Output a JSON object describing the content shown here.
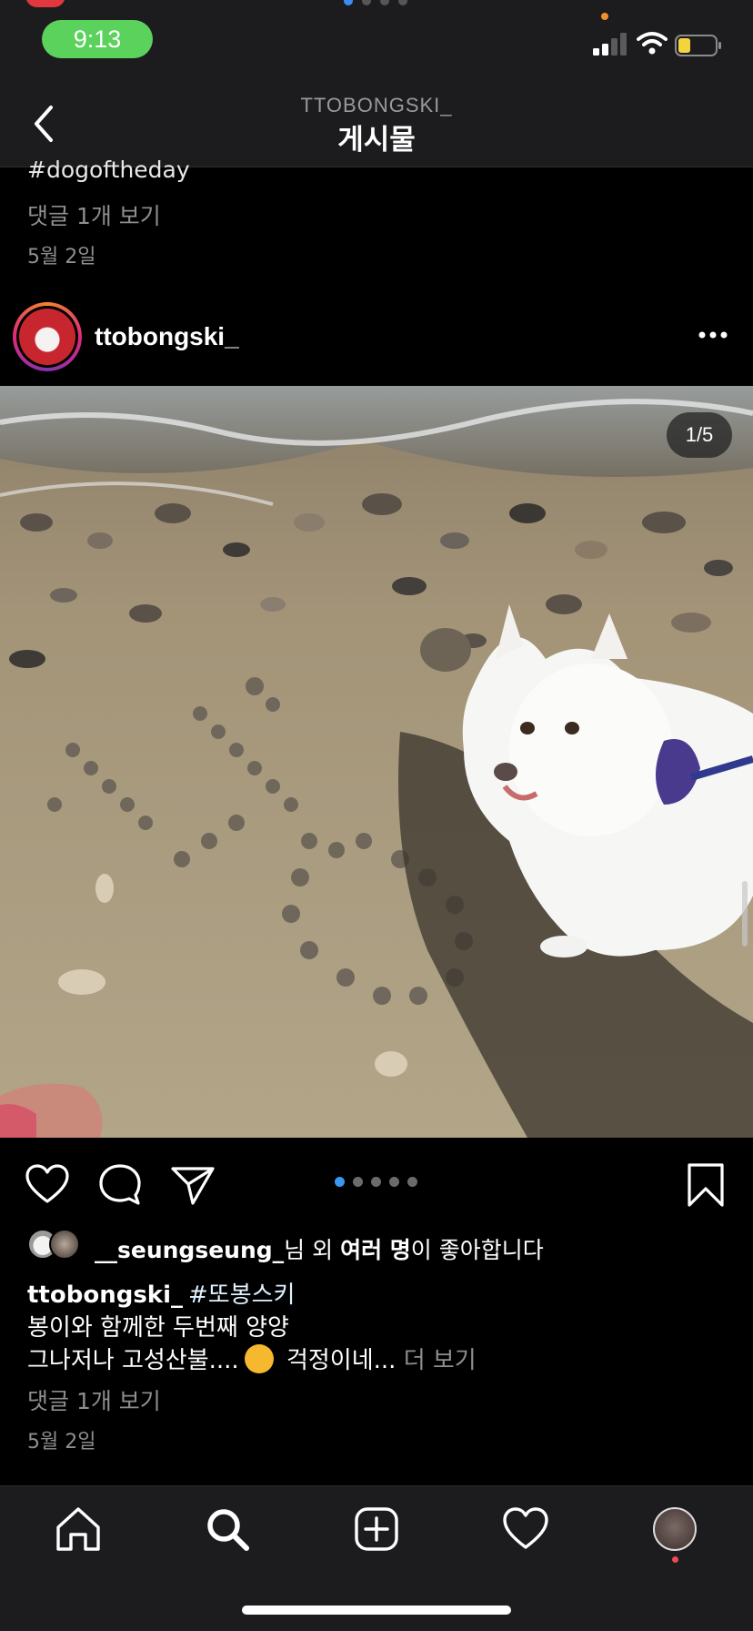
{
  "status_bar": {
    "time": "9:13"
  },
  "header": {
    "username": "TTOBONGSKI_",
    "title": "게시물"
  },
  "previous_post": {
    "hashtag": "#dogoftheday",
    "view_comments": "댓글 1개 보기",
    "date": "5월 2일"
  },
  "post": {
    "username": "ttobongski_",
    "image_counter": "1/5",
    "carousel": {
      "total": 5,
      "current": 1
    },
    "likes": {
      "liker": "__seungseung_",
      "text_mid": "님 외 ",
      "text_bold": "여러 명",
      "text_end": "이 좋아합니다"
    },
    "caption": {
      "username": "ttobongski_",
      "hashtag": "#또봉스키",
      "line2": "봉이와 함께한 두번째 양양",
      "line3_a": "그나저나 고성산불....",
      "line3_b": " 걱정이네...",
      "more": " 더 보기"
    },
    "view_comments": "댓글 1개 보기",
    "date": "5월 2일"
  },
  "icons": {
    "back": "chevron-left-icon",
    "more": "more-horizontal-icon",
    "like": "heart-icon",
    "comment": "comment-icon",
    "share": "paper-plane-icon",
    "save": "bookmark-icon",
    "home": "home-icon",
    "search": "search-icon",
    "create": "plus-square-icon",
    "activity": "heart-icon",
    "profile": "profile-avatar"
  },
  "colors": {
    "background": "#000000",
    "bar": "#1c1c1e",
    "accent_blue": "#3897f0",
    "time_pill": "#5bd25c",
    "muted_text": "#8e8e8e"
  }
}
